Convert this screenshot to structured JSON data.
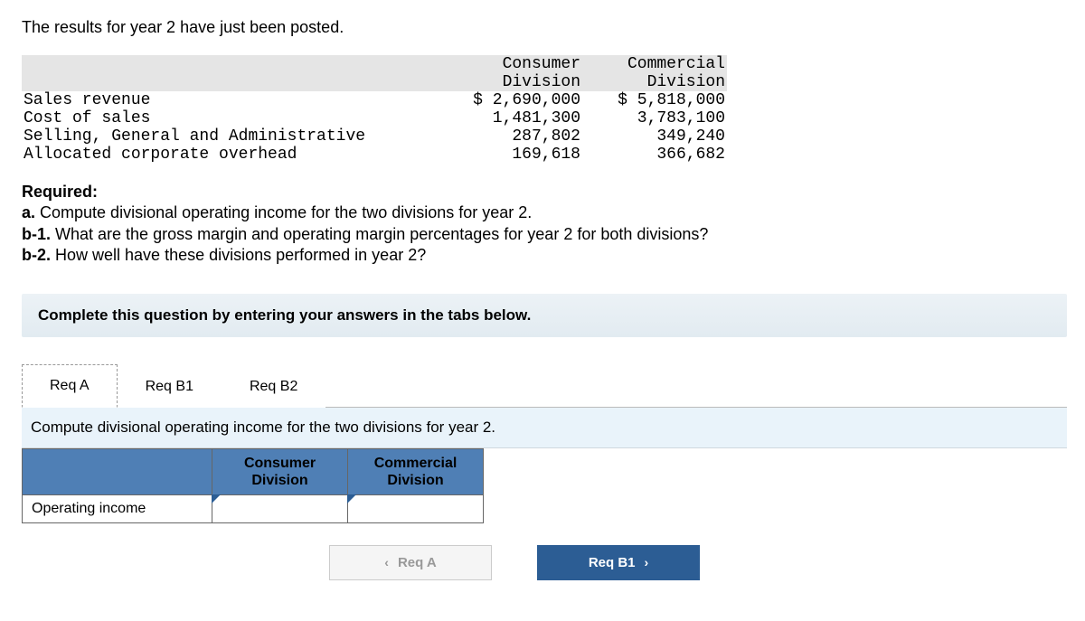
{
  "intro": "The results for year 2 have just been posted.",
  "data_table": {
    "header": {
      "blank": "",
      "col1_line1": "Consumer",
      "col1_line2": "Division",
      "col2_line1": "Commercial",
      "col2_line2": "Division"
    },
    "rows": [
      {
        "label": "Sales revenue",
        "c1": "$ 2,690,000",
        "c2": "$ 5,818,000"
      },
      {
        "label": "Cost of sales",
        "c1": "1,481,300",
        "c2": "3,783,100"
      },
      {
        "label": "Selling, General and Administrative",
        "c1": "287,802",
        "c2": "349,240"
      },
      {
        "label": "Allocated corporate overhead",
        "c1": "169,618",
        "c2": "366,682"
      }
    ]
  },
  "required": {
    "title": "Required:",
    "a_prefix": "a.",
    "a_text": " Compute divisional operating income for the two divisions for year 2.",
    "b1_prefix": "b-1.",
    "b1_text": " What are the gross margin and operating margin percentages for year 2 for both divisions?",
    "b2_prefix": "b-2.",
    "b2_text": " How well have these divisions performed in year 2?"
  },
  "instruction": "Complete this question by entering your answers in the tabs below.",
  "tabs": {
    "a": "Req A",
    "b1": "Req B1",
    "b2": "Req B2"
  },
  "tab_content": {
    "heading": "Compute divisional operating income for the two divisions for year 2.",
    "col1": "Consumer Division",
    "col2": "Commercial Division",
    "row_label": "Operating income"
  },
  "nav": {
    "prev": "Req A",
    "next": "Req B1"
  }
}
